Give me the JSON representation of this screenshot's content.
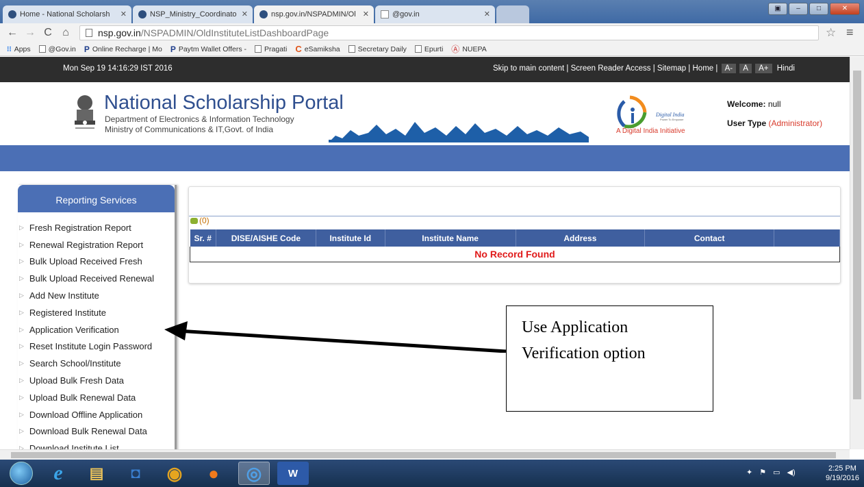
{
  "browser": {
    "tabs": [
      {
        "title": "Home - National Scholarsh"
      },
      {
        "title": "NSP_Ministry_Coordinato"
      },
      {
        "title": "nsp.gov.in/NSPADMIN/Ol"
      },
      {
        "title": "@gov.in"
      }
    ],
    "url_domain": "nsp.gov.in",
    "url_path": "/NSPADMIN/OldInstituteListDashboardPage",
    "bookmarks": [
      "Apps",
      "@Gov.in",
      "Online Recharge | Mo",
      "Paytm Wallet Offers -",
      "Pragati",
      "eSamiksha",
      "Secretary Daily",
      "Epurti",
      "NUEPA"
    ]
  },
  "topbar": {
    "datetime": "Mon Sep 19 14:16:29 IST 2016",
    "links": "Skip to main content | Screen Reader Access | Sitemap | Home |",
    "font_minus": "A-",
    "font_normal": "A",
    "font_plus": "A+",
    "language": "Hindi"
  },
  "header": {
    "title": "National Scholarship Portal",
    "dept_line1": "Department of Electronics & Information Technology",
    "dept_line2": "Ministry of Communications & IT,Govt. of India",
    "digital_india_caption": "A Digital India Initiative",
    "welcome_label": "Welcome:",
    "welcome_value": "null",
    "usertype_label": "User Type",
    "usertype_value": "(Administrator)"
  },
  "sidebar": {
    "heading": "Reporting Services",
    "items": [
      "Fresh Registration Report",
      "Renewal Registration Report",
      "Bulk Upload Received Fresh",
      "Bulk Upload Received Renewal",
      "Add New Institute",
      "Registered Institute",
      "Application Verification",
      "Reset Institute Login Password",
      "Search School/Institute",
      "Upload Bulk Fresh Data",
      "Upload Bulk Renewal Data",
      "Download Offline Application",
      "Download Bulk Renewal Data",
      "Download Institute List"
    ]
  },
  "table": {
    "count": "(0)",
    "columns": [
      "Sr. #",
      "DISE/AISHE Code",
      "Institute Id",
      "Institute Name",
      "Address",
      "Contact",
      ""
    ],
    "empty_message": "No Record Found"
  },
  "callout": {
    "line1": "Use Application",
    "line2": "Verification option"
  },
  "taskbar": {
    "time": "2:25 PM",
    "date": "9/19/2016"
  },
  "colors": {
    "brand_blue": "#4b6fb5",
    "title_blue": "#2f4f8f",
    "accent_red": "#d83a2b"
  }
}
